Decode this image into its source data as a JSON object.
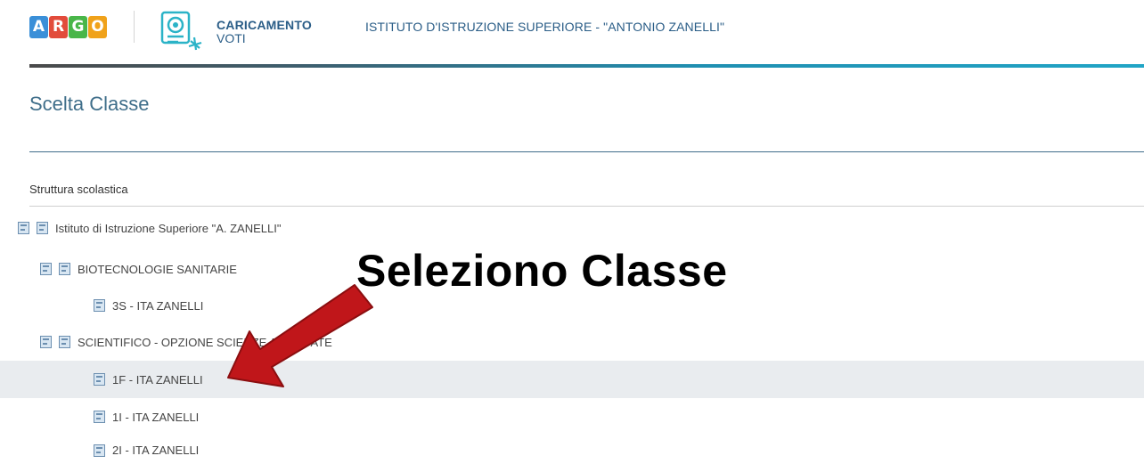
{
  "header": {
    "logo_letters": [
      {
        "char": "A",
        "color": "#3a8fd8"
      },
      {
        "char": "R",
        "color": "#e24b3b"
      },
      {
        "char": "G",
        "color": "#49b649"
      },
      {
        "char": "O",
        "color": "#f0a21a"
      }
    ],
    "app_name_line1": "CARICAMENTO",
    "app_name_line2": "VOTI",
    "school_name": "ISTITUTO D'ISTRUZIONE SUPERIORE - \"ANTONIO ZANELLI\""
  },
  "page": {
    "title": "Scelta Classe",
    "section_label": "Struttura scolastica"
  },
  "tree": [
    {
      "label": "Istituto di Istruzione Superiore \"A. ZANELLI\"",
      "level": 0,
      "icons": 2,
      "selected": false
    },
    {
      "label": "BIOTECNOLOGIE SANITARIE",
      "level": 1,
      "icons": 2,
      "selected": false
    },
    {
      "label": "3S - ITA ZANELLI",
      "level": 2,
      "icons": 1,
      "selected": false
    },
    {
      "label": "SCIENTIFICO - OPZIONE SCIENZE APPLICATE",
      "level": 1,
      "icons": 2,
      "selected": false
    },
    {
      "label": "1F - ITA ZANELLI",
      "level": 2,
      "icons": 1,
      "selected": true
    },
    {
      "label": "1I - ITA ZANELLI",
      "level": 2,
      "icons": 1,
      "selected": false
    },
    {
      "label": "2I - ITA ZANELLI",
      "level": 2,
      "icons": 1,
      "selected": false
    }
  ],
  "annotation": {
    "text": "Seleziono Classe",
    "arrow_color": "#c0161a"
  }
}
